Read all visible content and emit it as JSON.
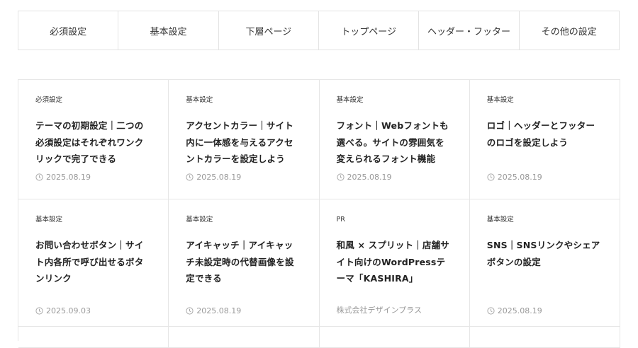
{
  "tabs": [
    "必須設定",
    "基本設定",
    "下層ページ",
    "トップページ",
    "ヘッダー・フッター",
    "その他の設定"
  ],
  "cards": [
    {
      "category": "必須設定",
      "title": "テーマの初期設定｜二つの必須設定はそれぞれワンクリックで完了できる",
      "date": "2025.08.19"
    },
    {
      "category": "基本設定",
      "title": "アクセントカラー｜サイト内に一体感を与えるアクセントカラーを設定しよう",
      "date": "2025.08.19"
    },
    {
      "category": "基本設定",
      "title": "フォント｜Webフォントも選べる。サイトの雰囲気を変えられるフォント機能",
      "date": "2025.08.19"
    },
    {
      "category": "基本設定",
      "title": "ロゴ｜ヘッダーとフッターのロゴを設定しよう",
      "date": "2025.08.19"
    },
    {
      "category": "基本設定",
      "title": "お問い合わせボタン｜サイト内各所で呼び出せるボタンリンク",
      "date": "2025.09.03"
    },
    {
      "category": "基本設定",
      "title": "アイキャッチ｜アイキャッチ未設定時の代替画像を設定できる",
      "date": "2025.08.19"
    },
    {
      "category": "PR",
      "title": "和風 × スプリット｜店舗サイト向けのWordPressテーマ「KASHIRA」",
      "company": "株式会社デザインプラス"
    },
    {
      "category": "基本設定",
      "title": "SNS｜SNSリンクやシェアボタンの設定",
      "date": "2025.08.19"
    }
  ],
  "icons": {
    "date": "clock-icon"
  },
  "colors": {
    "border": "#e6e6e6",
    "meta_text": "#999999",
    "title_text": "#222222"
  }
}
